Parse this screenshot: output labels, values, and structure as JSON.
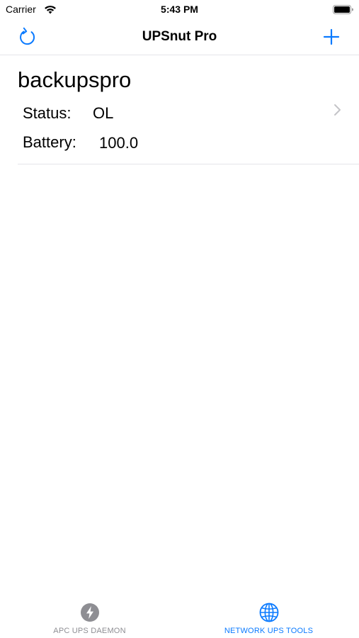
{
  "status_bar": {
    "carrier": "Carrier",
    "time": "5:43 PM",
    "icons": [
      "wifi-icon",
      "battery-icon"
    ]
  },
  "nav_bar": {
    "title": "UPSnut Pro",
    "left_icon": "refresh-icon",
    "right_icon": "plus-icon"
  },
  "ups_list": [
    {
      "name": "backupspro",
      "status_label": "Status:",
      "status_value": "OL",
      "battery_label": "Battery:",
      "battery_value": "100.0"
    }
  ],
  "tab_bar": {
    "tabs": [
      {
        "label": "APC UPS DAEMON",
        "icon": "bolt-icon",
        "selected": false
      },
      {
        "label": "NETWORK UPS TOOLS",
        "icon": "globe-icon",
        "selected": true
      }
    ]
  },
  "colors": {
    "accent": "#0a7aff",
    "inactive": "#8e8e93",
    "separator": "#e5e5ea",
    "chevron": "#c4c4c7"
  }
}
